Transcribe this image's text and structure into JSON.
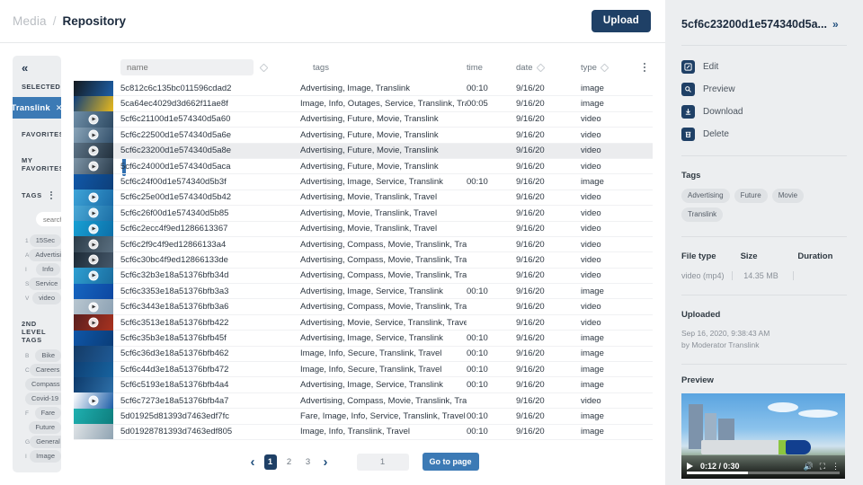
{
  "header": {
    "breadcrumb_parent": "Media",
    "breadcrumb_sep": "/",
    "breadcrumb_current": "Repository",
    "upload_label": "Upload"
  },
  "sidebar": {
    "collapse_icon": "«",
    "selected_label": "SELECTED",
    "action_icons": [
      "trash-icon",
      "star-icon",
      "stars-icon",
      "wand-icon"
    ],
    "selected_chip": {
      "label": "Translink",
      "remove": "✕"
    },
    "sections": [
      {
        "title": "FAVORITES"
      },
      {
        "title": "MY FAVORITES"
      },
      {
        "title": "TAGS"
      }
    ],
    "tag_search_placeholder": "search...",
    "tags": [
      {
        "letter": "1",
        "label": "15Sec"
      },
      {
        "letter": "A",
        "label": "Advertising"
      },
      {
        "letter": "I",
        "label": "Info"
      },
      {
        "letter": "S",
        "label": "Service"
      },
      {
        "letter": "V",
        "label": "video"
      }
    ],
    "second_level_title": "2ND LEVEL TAGS",
    "second_level_tags": [
      {
        "letter": "B",
        "label": "Bike"
      },
      {
        "letter": "C",
        "label": "Careers"
      },
      {
        "letter": "",
        "label": "Compass"
      },
      {
        "letter": "",
        "label": "Covid-19"
      },
      {
        "letter": "F",
        "label": "Fare"
      },
      {
        "letter": "",
        "label": "Future"
      },
      {
        "letter": "G",
        "label": "General"
      },
      {
        "letter": "I",
        "label": "Image"
      }
    ]
  },
  "table": {
    "columns": {
      "name_placeholder": "name",
      "tags": "tags",
      "time": "time",
      "date": "date",
      "type": "type"
    },
    "rows": [
      {
        "name": "5c812c6c135bc011596cdad2",
        "tags": "Advertising, Image, Translink",
        "time": "00:10",
        "date": "9/16/20",
        "type": "image",
        "media": "image",
        "selected": false
      },
      {
        "name": "5ca64ec4029d3d662f11ae8f",
        "tags": "Image, Info, Outages, Service, Translink, Tra...",
        "time": "00:05",
        "date": "9/16/20",
        "type": "image",
        "media": "image",
        "selected": false
      },
      {
        "name": "5cf6c21100d1e574340d5a60",
        "tags": "Advertising, Future, Movie, Translink",
        "time": "",
        "date": "9/16/20",
        "type": "video",
        "media": "video",
        "selected": false
      },
      {
        "name": "5cf6c22500d1e574340d5a6e",
        "tags": "Advertising, Future, Movie, Translink",
        "time": "",
        "date": "9/16/20",
        "type": "video",
        "media": "video",
        "selected": false
      },
      {
        "name": "5cf6c23200d1e574340d5a8e",
        "tags": "Advertising, Future, Movie, Translink",
        "time": "",
        "date": "9/16/20",
        "type": "video",
        "media": "video",
        "selected": true
      },
      {
        "name": "5cf6c24000d1e574340d5aca",
        "tags": "Advertising, Future, Movie, Translink",
        "time": "",
        "date": "9/16/20",
        "type": "video",
        "media": "video",
        "selected": false
      },
      {
        "name": "5cf6c24f00d1e574340d5b3f",
        "tags": "Advertising, Image, Service, Translink",
        "time": "00:10",
        "date": "9/16/20",
        "type": "image",
        "media": "image",
        "selected": false
      },
      {
        "name": "5cf6c25e00d1e574340d5b42",
        "tags": "Advertising, Movie, Translink, Travel",
        "time": "",
        "date": "9/16/20",
        "type": "video",
        "media": "video",
        "selected": false
      },
      {
        "name": "5cf6c26f00d1e574340d5b85",
        "tags": "Advertising, Movie, Translink, Travel",
        "time": "",
        "date": "9/16/20",
        "type": "video",
        "media": "video",
        "selected": false
      },
      {
        "name": "5cf6c2ecc4f9ed1286613367",
        "tags": "Advertising, Movie, Translink, Travel",
        "time": "",
        "date": "9/16/20",
        "type": "video",
        "media": "video",
        "selected": false
      },
      {
        "name": "5cf6c2f9c4f9ed12866133a4",
        "tags": "Advertising, Compass, Movie, Translink, Tra...",
        "time": "",
        "date": "9/16/20",
        "type": "video",
        "media": "video",
        "selected": false
      },
      {
        "name": "5cf6c30bc4f9ed12866133de",
        "tags": "Advertising, Compass, Movie, Translink, Tra...",
        "time": "",
        "date": "9/16/20",
        "type": "video",
        "media": "video",
        "selected": false
      },
      {
        "name": "5cf6c32b3e18a51376bfb34d",
        "tags": "Advertising, Compass, Movie, Translink, Tra...",
        "time": "",
        "date": "9/16/20",
        "type": "video",
        "media": "video",
        "selected": false
      },
      {
        "name": "5cf6c3353e18a51376bfb3a3",
        "tags": "Advertising, Image, Service, Translink",
        "time": "00:10",
        "date": "9/16/20",
        "type": "image",
        "media": "image",
        "selected": false
      },
      {
        "name": "5cf6c3443e18a51376bfb3a6",
        "tags": "Advertising, Compass, Movie, Translink, Tra...",
        "time": "",
        "date": "9/16/20",
        "type": "video",
        "media": "video",
        "selected": false
      },
      {
        "name": "5cf6c3513e18a51376bfb422",
        "tags": "Advertising, Movie, Service, Translink, Travel",
        "time": "",
        "date": "9/16/20",
        "type": "video",
        "media": "video",
        "selected": false
      },
      {
        "name": "5cf6c35b3e18a51376bfb45f",
        "tags": "Advertising, Image, Service, Translink",
        "time": "00:10",
        "date": "9/16/20",
        "type": "image",
        "media": "image",
        "selected": false
      },
      {
        "name": "5cf6c36d3e18a51376bfb462",
        "tags": "Image, Info, Secure, Translink, Travel",
        "time": "00:10",
        "date": "9/16/20",
        "type": "image",
        "media": "image",
        "selected": false
      },
      {
        "name": "5cf6c44d3e18a51376bfb472",
        "tags": "Image, Info, Secure, Translink, Travel",
        "time": "00:10",
        "date": "9/16/20",
        "type": "image",
        "media": "image",
        "selected": false
      },
      {
        "name": "5cf6c5193e18a51376bfb4a4",
        "tags": "Advertising, Image, Service, Translink",
        "time": "00:10",
        "date": "9/16/20",
        "type": "image",
        "media": "image",
        "selected": false
      },
      {
        "name": "5cf6c7273e18a51376bfb4a7",
        "tags": "Advertising, Compass, Movie, Translink, Tra...",
        "time": "",
        "date": "9/16/20",
        "type": "video",
        "media": "video",
        "selected": false
      },
      {
        "name": "5d01925d81393d7463edf7fc",
        "tags": "Fare, Image, Info, Service, Translink, Travel",
        "time": "00:10",
        "date": "9/16/20",
        "type": "image",
        "media": "image",
        "selected": false
      },
      {
        "name": "5d01928781393d7463edf805",
        "tags": "Image, Info, Translink, Travel",
        "time": "00:10",
        "date": "9/16/20",
        "type": "image",
        "media": "image",
        "selected": false
      }
    ]
  },
  "pagination": {
    "prev": "‹",
    "next": "›",
    "pages": [
      "1",
      "2",
      "3"
    ],
    "active_page": "1",
    "goto_value": "1",
    "goto_label": "Go to page"
  },
  "details": {
    "title": "5cf6c23200d1e574340d5a...",
    "expand_icon": "»",
    "actions": [
      {
        "label": "Edit",
        "icon": "edit-icon",
        "glyph": "✎"
      },
      {
        "label": "Preview",
        "icon": "preview-icon",
        "glyph": "⚲"
      },
      {
        "label": "Download",
        "icon": "download-icon",
        "glyph": "↓"
      },
      {
        "label": "Delete",
        "icon": "delete-icon",
        "glyph": "⌧"
      }
    ],
    "tags_heading": "Tags",
    "tags": [
      "Advertising",
      "Future",
      "Movie",
      "Translink"
    ],
    "meta_headers": {
      "file_type": "File type",
      "size": "Size",
      "duration": "Duration"
    },
    "meta_values": {
      "file_type": "video (mp4)",
      "size": "14.35 MB",
      "duration": ""
    },
    "uploaded_heading": "Uploaded",
    "uploaded_date": "Sep 16, 2020, 9:38:43 AM",
    "uploaded_by": "by Moderator Translink",
    "preview_heading": "Preview",
    "player": {
      "time": "0:12 / 0:30",
      "progress_pct": 40
    }
  },
  "colors": {
    "accent_dark": "#1f4066",
    "accent_blue": "#3c7ab5",
    "panel_bg": "#eceef0",
    "text_dark": "#1b2a3d"
  }
}
